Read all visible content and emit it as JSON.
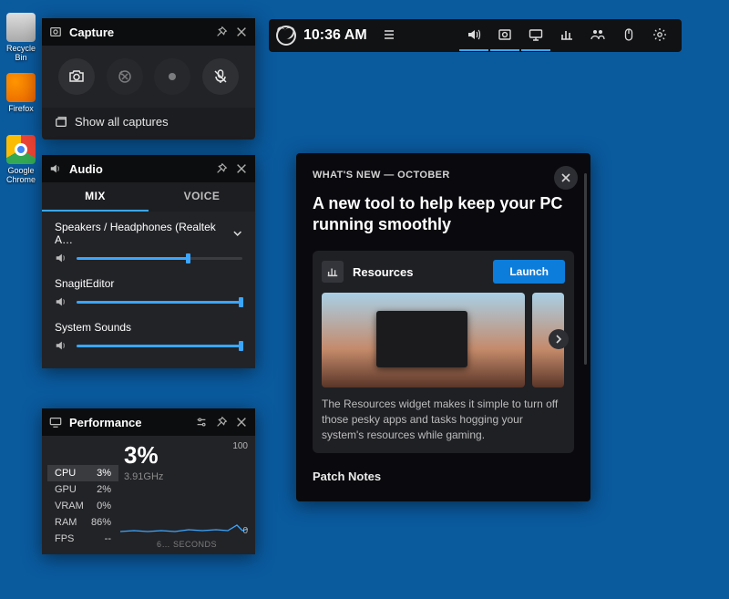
{
  "desktop": {
    "icons": [
      {
        "label": "Recycle Bin"
      },
      {
        "label": "Firefox"
      },
      {
        "label": "Google Chrome"
      }
    ]
  },
  "topbar": {
    "time": "10:36 AM"
  },
  "capture": {
    "title": "Capture",
    "show_all": "Show all captures"
  },
  "audio": {
    "title": "Audio",
    "tabs": {
      "mix": "MIX",
      "voice": "VOICE"
    },
    "device": "Speakers / Headphones (Realtek A…",
    "device_vol": 67,
    "apps": [
      {
        "name": "SnagitEditor",
        "vol": 100
      },
      {
        "name": "System Sounds",
        "vol": 100
      }
    ]
  },
  "performance": {
    "title": "Performance",
    "metrics": [
      {
        "name": "CPU",
        "val": "3%"
      },
      {
        "name": "GPU",
        "val": "2%"
      },
      {
        "name": "VRAM",
        "val": "0%"
      },
      {
        "name": "RAM",
        "val": "86%"
      },
      {
        "name": "FPS",
        "val": "--"
      }
    ],
    "big": "3%",
    "freq": "3.91GHz",
    "y_max": "100",
    "y_min": "0",
    "caption": "6… SECONDS"
  },
  "whatsnew": {
    "eyebrow": "WHAT'S NEW — OCTOBER",
    "headline": "A new tool to help keep your PC running smoothly",
    "card_title": "Resources",
    "launch": "Launch",
    "desc": "The Resources widget makes it simple to turn off those pesky apps and tasks hogging your system's resources while gaming.",
    "patch": "Patch Notes"
  }
}
